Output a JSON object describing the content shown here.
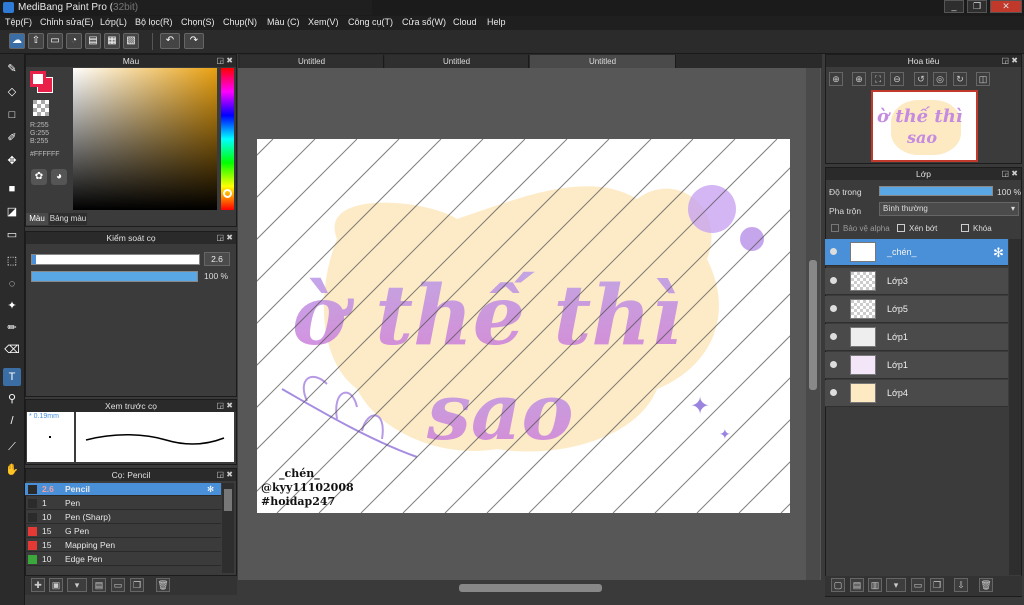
{
  "window": {
    "title": "MediBang Paint Pro (32bit)"
  },
  "menu": [
    "Tệp(F)",
    "Chỉnh sửa(E)",
    "Lớp(L)",
    "Bộ lọc(R)",
    "Chọn(S)",
    "Chụp(N)",
    "Màu (C)",
    "Xem(V)",
    "Công cụ(T)",
    "Cửa sổ(W)",
    "Cloud",
    "Help"
  ],
  "tabs": [
    "Untitled",
    "Untitled",
    "Untitled"
  ],
  "color_panel": {
    "title": "Màu",
    "rgb": [
      "R:255",
      "G:255",
      "B:255"
    ],
    "hex": "#FFFFFF",
    "tab_color": "Màu",
    "tab_palette": "Bảng màu"
  },
  "brush_control": {
    "title": "Kiểm soát cọ",
    "size": "2.6",
    "opacity": "100 %"
  },
  "brush_preview": {
    "title": "Xem trước cọ",
    "size_label": "0.19mm"
  },
  "brush_list": {
    "title": "Cọ: Pencil",
    "items": [
      {
        "size": "2.6",
        "name": "Pencil",
        "color": "#2b2b2b",
        "selected": true
      },
      {
        "size": "1",
        "name": "Pen",
        "color": "#2b2b2b"
      },
      {
        "size": "10",
        "name": "Pen (Sharp)",
        "color": "#2b2b2b"
      },
      {
        "size": "15",
        "name": "G Pen",
        "color": "#e53935"
      },
      {
        "size": "15",
        "name": "Mapping Pen",
        "color": "#e53935"
      },
      {
        "size": "10",
        "name": "Edge Pen",
        "color": "#3aa83a"
      }
    ]
  },
  "navigator": {
    "title": "Hoa tiêu"
  },
  "layer_panel": {
    "title": "Lớp",
    "opacity_label": "Độ trong",
    "opacity_value": "100 %",
    "blend_label": "Pha trộn",
    "blend_value": "Bình thường",
    "protect_alpha": "Bảo vệ alpha",
    "clipping": "Xén bớt",
    "lock": "Khóa"
  },
  "layers": [
    {
      "name": "_chén_",
      "selected": true
    },
    {
      "name": "Lớp3"
    },
    {
      "name": "Lớp5"
    },
    {
      "name": "Lớp1"
    },
    {
      "name": "Lớp1"
    },
    {
      "name": "Lớp4"
    }
  ],
  "artwork": {
    "line1": "ờ thế thì",
    "line2": "sao",
    "credit1": "_chén_",
    "credit2": "@kyy11102008",
    "credit3": "#hoidap247"
  },
  "colors": {
    "accent": "#4a90d9",
    "fg": "#e8204a",
    "bg": "#ffffff"
  }
}
